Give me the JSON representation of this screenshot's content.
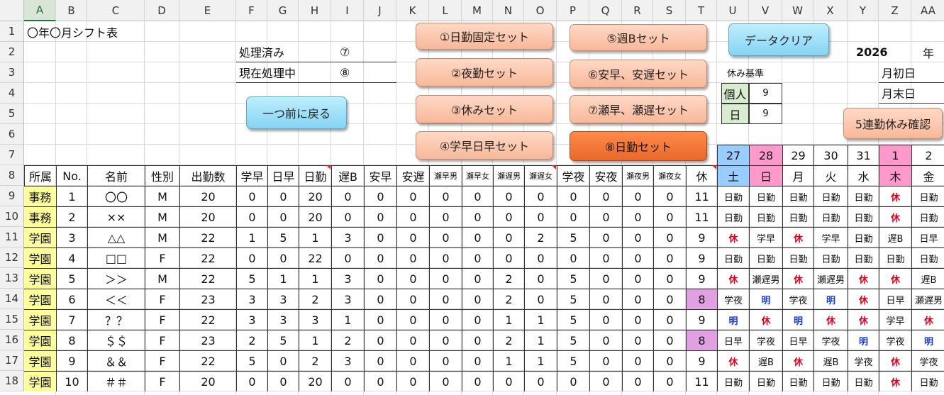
{
  "columns": [
    "A",
    "B",
    "C",
    "D",
    "E",
    "F",
    "G",
    "H",
    "I",
    "J",
    "K",
    "L",
    "M",
    "N",
    "O",
    "P",
    "Q",
    "R",
    "S",
    "T",
    "U",
    "V",
    "W",
    "X",
    "Y",
    "Z",
    "AA"
  ],
  "rows": [
    "1",
    "2",
    "3",
    "4",
    "5",
    "6",
    "7",
    "8",
    "9",
    "10",
    "11",
    "12",
    "13",
    "14",
    "15",
    "16",
    "17",
    "18"
  ],
  "title": "〇年〇月シフト表",
  "status": {
    "done_label": "処理済み",
    "done_value": "⑦",
    "current_label": "現在処理中",
    "current_value": "⑧"
  },
  "buttons": {
    "back": "一つ前に戻る",
    "b1": "①日勤固定セット",
    "b2": "②夜勤セット",
    "b3": "③休みセット",
    "b4": "④学早日早セット",
    "b5": "⑤週Bセット",
    "b6": "⑥安早、安遅セット",
    "b7": "⑦瀬早、瀬遅セット",
    "b8": "⑧日勤セット",
    "clear": "データクリア",
    "check5": "5連勤休み確認"
  },
  "year": {
    "value": "2026",
    "unit": "年"
  },
  "month_first": "月初日",
  "month_last": "月末日",
  "rest_basis": {
    "title": "休み基準",
    "individual_label": "個人",
    "individual_value": "9",
    "day_label": "日",
    "day_value": "9"
  },
  "colors": {
    "peach": "#f7b89a",
    "blue_button": "#86d4f2",
    "orange_button": "#e8682a",
    "yellow": "#ffff99",
    "pink": "#ff99cc",
    "sat_blue": "#99ccff",
    "violet": "#e1a0e1"
  },
  "dates": [
    "27",
    "28",
    "29",
    "30",
    "31",
    "1",
    "2"
  ],
  "weekdays": [
    "土",
    "日",
    "月",
    "火",
    "水",
    "木",
    "金"
  ],
  "header": [
    "所属",
    "No.",
    "名前",
    "性別",
    "出勤数",
    "学早",
    "日早",
    "日勤",
    "遅B",
    "安早",
    "安遅",
    "瀬早男",
    "瀬早女",
    "瀬遅男",
    "瀬遅女",
    "学夜",
    "安夜",
    "瀬夜男",
    "瀬夜女",
    "休"
  ],
  "table": [
    {
      "dept": "事務",
      "no": "1",
      "name": "〇〇",
      "sex": "M",
      "work": "20",
      "c": [
        "0",
        "0",
        "20",
        "0",
        "0",
        "0",
        "0",
        "0",
        "0",
        "0",
        "0",
        "0",
        "0",
        "0"
      ],
      "rest": "11",
      "shifts": [
        "日勤",
        "日勤",
        "日勤",
        "日勤",
        "日勤",
        "休",
        "日勤"
      ]
    },
    {
      "dept": "事務",
      "no": "2",
      "name": "××",
      "sex": "M",
      "work": "20",
      "c": [
        "0",
        "0",
        "20",
        "0",
        "0",
        "0",
        "0",
        "0",
        "0",
        "0",
        "0",
        "0",
        "0",
        "0"
      ],
      "rest": "11",
      "shifts": [
        "日勤",
        "日勤",
        "日勤",
        "日勤",
        "日勤",
        "休",
        "日勤"
      ]
    },
    {
      "dept": "学園",
      "no": "3",
      "name": "△△",
      "sex": "M",
      "work": "22",
      "c": [
        "1",
        "5",
        "1",
        "3",
        "0",
        "0",
        "0",
        "0",
        "0",
        "2",
        "5",
        "0",
        "0",
        "0"
      ],
      "rest": "9",
      "shifts": [
        "休",
        "学早",
        "休",
        "学早",
        "日勤",
        "遅B",
        "日早"
      ]
    },
    {
      "dept": "学園",
      "no": "4",
      "name": "□□",
      "sex": "F",
      "work": "22",
      "c": [
        "0",
        "0",
        "22",
        "0",
        "0",
        "0",
        "0",
        "0",
        "0",
        "0",
        "0",
        "0",
        "0",
        "0"
      ],
      "rest": "9",
      "shifts": [
        "日勤",
        "日勤",
        "日勤",
        "日勤",
        "日勤",
        "日勤",
        "日勤"
      ]
    },
    {
      "dept": "学園",
      "no": "5",
      "name": "＞＞",
      "sex": "M",
      "work": "22",
      "c": [
        "5",
        "1",
        "1",
        "3",
        "0",
        "0",
        "0",
        "0",
        "2",
        "0",
        "5",
        "0",
        "0",
        "0"
      ],
      "rest": "9",
      "shifts": [
        "休",
        "瀬遅男",
        "休",
        "瀬遅男",
        "休",
        "休",
        "遅B"
      ]
    },
    {
      "dept": "学園",
      "no": "6",
      "name": "＜＜",
      "sex": "F",
      "work": "23",
      "c": [
        "3",
        "3",
        "2",
        "3",
        "0",
        "0",
        "0",
        "0",
        "2",
        "0",
        "5",
        "0",
        "0",
        "0"
      ],
      "rest": "8",
      "shifts": [
        "学夜",
        "明",
        "学夜",
        "明",
        "休",
        "日早",
        "瀬遅男"
      ]
    },
    {
      "dept": "学園",
      "no": "7",
      "name": "？？",
      "sex": "F",
      "work": "22",
      "c": [
        "3",
        "3",
        "3",
        "1",
        "0",
        "0",
        "0",
        "0",
        "1",
        "1",
        "5",
        "0",
        "0",
        "0"
      ],
      "rest": "9",
      "shifts": [
        "明",
        "休",
        "明",
        "休",
        "休",
        "学早",
        "休"
      ]
    },
    {
      "dept": "学園",
      "no": "8",
      "name": "＄＄",
      "sex": "F",
      "work": "23",
      "c": [
        "2",
        "5",
        "1",
        "2",
        "0",
        "0",
        "0",
        "0",
        "2",
        "1",
        "5",
        "0",
        "0",
        "0"
      ],
      "rest": "8",
      "shifts": [
        "日早",
        "学夜",
        "日早",
        "学夜",
        "明",
        "学夜",
        "明"
      ]
    },
    {
      "dept": "学園",
      "no": "9",
      "name": "＆＆",
      "sex": "F",
      "work": "22",
      "c": [
        "5",
        "0",
        "2",
        "3",
        "0",
        "0",
        "0",
        "0",
        "1",
        "1",
        "5",
        "0",
        "0",
        "0"
      ],
      "rest": "9",
      "shifts": [
        "休",
        "遅B",
        "休",
        "遅B",
        "学夜",
        "休",
        "学夜"
      ]
    },
    {
      "dept": "学園",
      "no": "10",
      "name": "＃＃",
      "sex": "F",
      "work": "20",
      "c": [
        "0",
        "0",
        "20",
        "0",
        "0",
        "0",
        "0",
        "0",
        "0",
        "0",
        "0",
        "0",
        "0",
        "0"
      ],
      "rest": "11",
      "shifts": [
        "日勤",
        "日勤",
        "日勤",
        "日勤",
        "日勤",
        "休",
        "日勤"
      ]
    }
  ]
}
